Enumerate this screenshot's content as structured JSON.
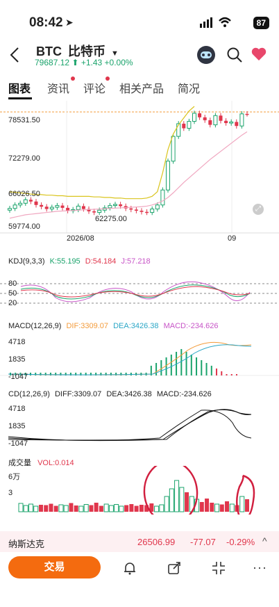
{
  "status_bar": {
    "time": "08:42",
    "battery": "87"
  },
  "header": {
    "symbol": "BTC",
    "name": "比特币",
    "price": "79687.12",
    "change": "+1.43",
    "change_pct": "+0.00%"
  },
  "tabs": [
    "图表",
    "资讯",
    "评论",
    "相关产品",
    "简况"
  ],
  "main_chart": {
    "y_labels": [
      "78531.50",
      "72279.00",
      "66026.50",
      "59774.00"
    ],
    "low_marker": "62275.00",
    "x_labels": [
      "2026/08",
      "09"
    ]
  },
  "kdj": {
    "label": "KDJ(9,3,3)",
    "k": "K:55.195",
    "d": "D:54.184",
    "j": "J:57.218",
    "levels": [
      "80",
      "50",
      "20"
    ]
  },
  "macd": {
    "label": "MACD(12,26,9)",
    "dif": "DIF:3309.07",
    "dea": "DEA:3426.38",
    "macd": "MACD:-234.626",
    "y_labels": [
      "4718",
      "1835",
      "-1047"
    ]
  },
  "cd": {
    "label": "CD(12,26,9)",
    "diff": "DIFF:3309.07",
    "dea": "DEA:3426.38",
    "macd": "MACD:-234.626",
    "y_labels": [
      "4718",
      "1835",
      "-1047"
    ]
  },
  "volume": {
    "label": "成交量",
    "vol": "VOL:0.014",
    "y_labels": [
      "6万",
      "3"
    ]
  },
  "ticker": {
    "name": "纳斯达克",
    "price": "26506.99",
    "change": "-77.07",
    "pct": "-0.29%"
  },
  "actions": {
    "trade": "交易"
  },
  "colors": {
    "up": "#1aa36b",
    "down": "#e0364c",
    "accent": "#f46b0f"
  },
  "chart_data": [
    {
      "type": "candlestick",
      "title": "BTC",
      "ylim": [
        59774.0,
        81000.0
      ],
      "series": [
        {
          "name": "close",
          "values": [
            63300,
            63900,
            64200,
            64800,
            64500,
            63900,
            63600,
            63200,
            63500,
            63800,
            63400,
            62900,
            63100,
            63700,
            63200,
            62800,
            62600,
            63000,
            63400,
            63800,
            64000,
            63700,
            63300,
            63100,
            62900,
            62700,
            62600,
            63200,
            63900,
            66500,
            71500,
            75800,
            78000,
            77200,
            78400,
            79800,
            79100,
            78600,
            77800,
            79400,
            78500,
            78100,
            78300,
            77600,
            79700,
            79687
          ]
        },
        {
          "name": "upper band",
          "values": [
            66200,
            66100,
            66000,
            65900,
            65800,
            65700,
            65700,
            65600,
            65600,
            65500,
            65500,
            65400,
            65400,
            65400,
            65400,
            65400,
            65300,
            65300,
            65200,
            65200,
            65100,
            65100,
            65000,
            65000,
            65000,
            65000,
            65100,
            65400,
            66200,
            69500,
            73500,
            76200,
            77800,
            79000,
            80200,
            81000
          ]
        },
        {
          "name": "moving average",
          "values": [
            61600,
            61800,
            62000,
            62200,
            62300,
            62400,
            62500,
            62600,
            62700,
            62800,
            62850,
            62900,
            62950,
            63000,
            63050,
            63100,
            63150,
            63200,
            63250,
            63300,
            63350,
            63400,
            63450,
            63500,
            63550,
            63600,
            63700,
            63900,
            64200,
            64600,
            65200,
            66000,
            66900,
            67800,
            68600,
            69400,
            70200,
            71000,
            71800,
            72500,
            73200,
            73900,
            74600,
            75300,
            76000,
            76600
          ]
        }
      ]
    },
    {
      "type": "bar",
      "title": "成交量",
      "ylim": [
        0,
        60000
      ],
      "values": [
        12000,
        9000,
        11000,
        8000,
        10000,
        9500,
        11500,
        8500,
        10000,
        9000,
        12500,
        9000,
        8000,
        10500,
        9500,
        13000,
        8500,
        11000,
        9000,
        10500,
        8000,
        9500,
        11000,
        8500,
        10000,
        9500,
        12000,
        8000,
        10000,
        22000,
        33000,
        45000,
        35000,
        28000,
        22000,
        18000,
        14000,
        19000,
        13000,
        11000,
        10500,
        15000,
        11000,
        9500,
        22000,
        18000
      ]
    }
  ]
}
